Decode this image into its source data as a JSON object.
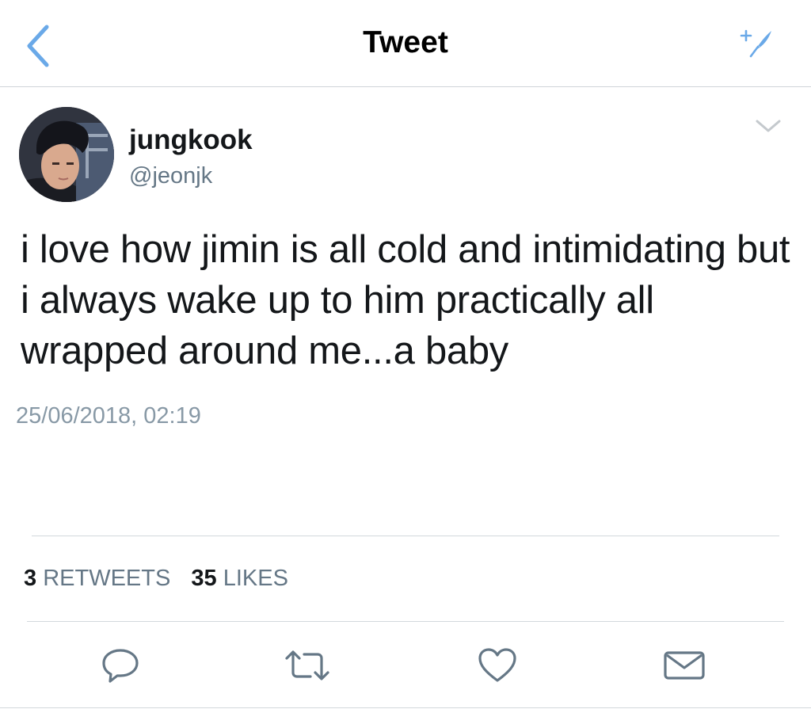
{
  "nav": {
    "title": "Tweet",
    "back_icon": "chevron-left-icon",
    "compose_icon": "compose-feather-icon"
  },
  "tweet": {
    "display_name": "jungkook",
    "handle": "@jeonjk",
    "text": "i love how jimin is all cold and intimidating but i always wake up to him practically all wrapped around me...a baby",
    "timestamp": "25/06/2018, 02:19"
  },
  "stats": {
    "retweets_count": "3",
    "retweets_label": "RETWEETS",
    "likes_count": "35",
    "likes_label": "LIKES"
  },
  "actions": [
    "reply-icon",
    "retweet-icon",
    "like-icon",
    "share-mail-icon"
  ],
  "colors": {
    "accent": "#1da1f2",
    "action_gray": "#657786",
    "secondary_text": "#8899a6"
  }
}
